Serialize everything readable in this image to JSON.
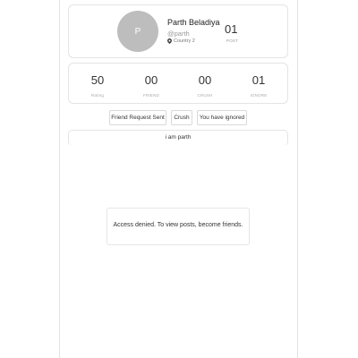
{
  "profile": {
    "avatar_letter": "P",
    "name": "Parth Beladiya",
    "handle": "@parth",
    "location": "Country 2",
    "post_count": "01",
    "post_label": "POST"
  },
  "stats": [
    {
      "value": "50",
      "label": "Rating"
    },
    {
      "value": "00",
      "label": "FRIEND"
    },
    {
      "value": "00",
      "label": "CRUSH"
    },
    {
      "value": "01",
      "label": "IGNORE"
    }
  ],
  "actions": {
    "friend_request": "Friend Request Sent",
    "crush": "Crush",
    "ignored": "You have ignored"
  },
  "bio": "i am parth",
  "posts_notice": "Access denied. To view posts, become friends.",
  "icons": {
    "location": "map-pin-icon"
  },
  "colors": {
    "avatar_bg": "#bdbdbd",
    "border": "#e4e4e4"
  }
}
